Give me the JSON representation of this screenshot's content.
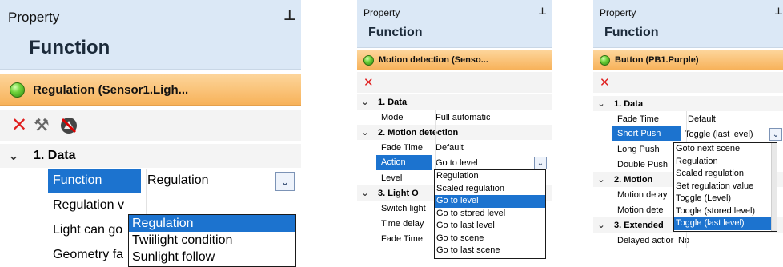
{
  "panel1": {
    "header": {
      "title": "Property",
      "pin_icon": "pin-icon",
      "function_title": "Function"
    },
    "object": {
      "label": "Regulation (Sensor1.Ligh..."
    },
    "toolbar": {
      "icons": [
        "delete-icon",
        "tools-icon",
        "unlink-icon"
      ]
    },
    "categories": [
      {
        "label": "1. Data"
      }
    ],
    "rows": [
      {
        "name": "Function",
        "value": "Regulation"
      },
      {
        "name": "Regulation v",
        "value": ""
      },
      {
        "name": "Light can go",
        "value": ""
      },
      {
        "name": "Geometry fa",
        "value": ""
      }
    ],
    "dropdown": {
      "options": [
        "Regulation",
        "Twiilight condition",
        "Sunlight follow"
      ],
      "selected": "Regulation"
    }
  },
  "panel2": {
    "header": {
      "title": "Property",
      "pin_icon": "pin-icon",
      "function_title": "Function"
    },
    "object": {
      "label": "Motion detection (Senso..."
    },
    "toolbar": {
      "icons": [
        "delete-icon"
      ]
    },
    "categories": [
      {
        "label": "1. Data"
      },
      {
        "label": "2. Motion detection"
      },
      {
        "label": "3. Light O"
      }
    ],
    "rows": [
      {
        "name": "Mode",
        "value": "Full automatic"
      },
      {
        "name": "Fade Time",
        "value": "Default"
      },
      {
        "name": "Action",
        "value": "Go to level"
      },
      {
        "name": "Level",
        "value": ""
      },
      {
        "name": "Switch light",
        "value": ""
      },
      {
        "name": "Time delay",
        "value": ""
      },
      {
        "name": "Fade Time",
        "value": ""
      }
    ],
    "dropdown": {
      "options": [
        "Regulation",
        "Scaled regulation",
        "Go to level",
        "Go to stored level",
        "Go to last level",
        "Go to scene",
        "Go to last scene"
      ],
      "selected": "Go to level"
    }
  },
  "panel3": {
    "header": {
      "title": "Property",
      "pin_icon": "pin-icon",
      "function_title": "Function"
    },
    "object": {
      "label": "Button (PB1.Purple)"
    },
    "toolbar": {
      "icons": [
        "delete-icon"
      ]
    },
    "categories": [
      {
        "label": "1. Data"
      },
      {
        "label": "2. Motion"
      },
      {
        "label": "3. Extended"
      }
    ],
    "rows": [
      {
        "name": "Fade Time",
        "value": "Default"
      },
      {
        "name": "Short Push",
        "value": "Toggle (last level)"
      },
      {
        "name": "Long Push",
        "value": ""
      },
      {
        "name": "Double Push",
        "value": ""
      },
      {
        "name": "Motion delay",
        "value": ""
      },
      {
        "name": "Motion dete",
        "value": ""
      },
      {
        "name": "Delayed actior",
        "value": "No"
      }
    ],
    "dropdown": {
      "options": [
        "Goto next scene",
        "Regulation",
        "Scaled regulation",
        "Set regulation value",
        "Toggle (Level)",
        "Toogle (stored level)",
        "Toggle (last level)"
      ],
      "selected": "Toggle (last level)"
    }
  },
  "colors": {
    "selection": "#1c73cf",
    "header_bg": "#dbe8f6",
    "object_bar": "#f7b25a",
    "status_green": "#6fd23a",
    "delete_red": "#e02020"
  }
}
